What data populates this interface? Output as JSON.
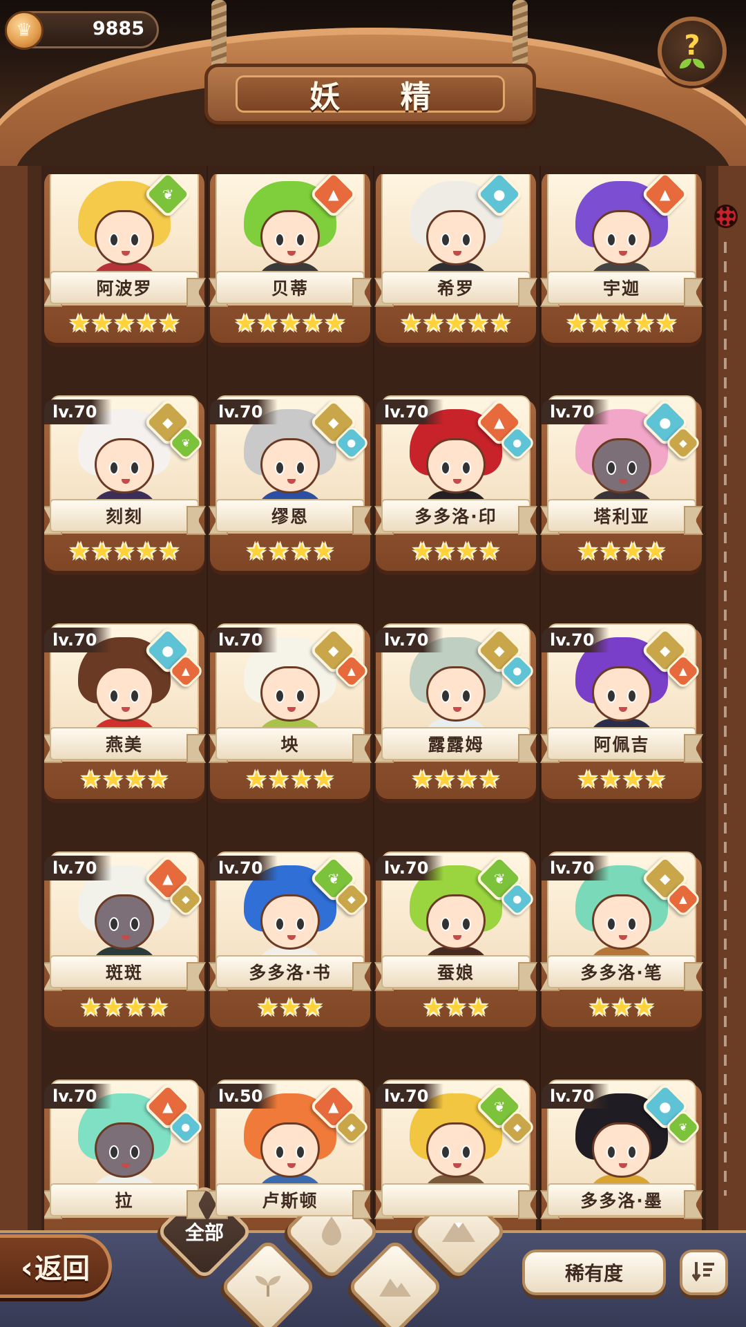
{
  "header": {
    "title": "妖 精",
    "coins": "9885",
    "coin_icon": "crown-coin-icon",
    "help_icon": "question-sprout-icon"
  },
  "colors": {
    "fire": "#e76a3c",
    "leaf": "#7cc23a",
    "water": "#5fc3d6",
    "earth": "#c9a64a",
    "gold_star": "#ffd23c"
  },
  "cards": [
    {
      "name": "阿波罗",
      "level": "",
      "stars": 5,
      "elements": [
        "leaf"
      ],
      "hair": "#f5c94a",
      "outfit": "#b7333a",
      "skin": "light"
    },
    {
      "name": "贝蒂",
      "level": "",
      "stars": 5,
      "elements": [
        "fire"
      ],
      "hair": "#7fcf3c",
      "outfit": "#3a3a3a",
      "skin": "light"
    },
    {
      "name": "希罗",
      "level": "",
      "stars": 5,
      "elements": [
        "water"
      ],
      "hair": "#efece6",
      "outfit": "#2f2f33",
      "skin": "light"
    },
    {
      "name": "宇迦",
      "level": "",
      "stars": 5,
      "elements": [
        "fire"
      ],
      "hair": "#7c4ed1",
      "outfit": "#444",
      "skin": "light"
    },
    {
      "name": "刻刻",
      "level": "lv.70",
      "stars": 5,
      "elements": [
        "earth",
        "leaf"
      ],
      "hair": "#f4f1ee",
      "outfit": "#3b2f5a",
      "skin": "light"
    },
    {
      "name": "缪恩",
      "level": "lv.70",
      "stars": 4,
      "elements": [
        "earth",
        "water"
      ],
      "hair": "#c9c9c9",
      "outfit": "#2d4fa3",
      "skin": "light"
    },
    {
      "name": "多多洛·印",
      "level": "lv.70",
      "stars": 4,
      "elements": [
        "fire",
        "water"
      ],
      "hair": "#c8222a",
      "outfit": "#242024",
      "skin": "light"
    },
    {
      "name": "塔利亚",
      "level": "lv.70",
      "stars": 4,
      "elements": [
        "water",
        "earth"
      ],
      "hair": "#f2a6c8",
      "outfit": "#3a3438",
      "skin": "dark"
    },
    {
      "name": "燕美",
      "level": "lv.70",
      "stars": 4,
      "elements": [
        "water",
        "fire"
      ],
      "hair": "#6a3a24",
      "outfit": "#d0312d",
      "skin": "light"
    },
    {
      "name": "坱",
      "level": "lv.70",
      "stars": 4,
      "elements": [
        "earth",
        "fire"
      ],
      "hair": "#f6f3e9",
      "outfit": "#a8c24a",
      "skin": "light"
    },
    {
      "name": "露露姆",
      "level": "lv.70",
      "stars": 4,
      "elements": [
        "earth",
        "water"
      ],
      "hair": "#bfcfc2",
      "outfit": "#e9eef0",
      "skin": "light"
    },
    {
      "name": "阿佩吉",
      "level": "lv.70",
      "stars": 4,
      "elements": [
        "earth",
        "fire"
      ],
      "hair": "#7a3fc8",
      "outfit": "#2a2e4a",
      "skin": "light"
    },
    {
      "name": "斑斑",
      "level": "lv.70",
      "stars": 4,
      "elements": [
        "fire",
        "earth"
      ],
      "hair": "#f2f2ea",
      "outfit": "#2b3a3a",
      "skin": "dark"
    },
    {
      "name": "多多洛·书",
      "level": "lv.70",
      "stars": 3,
      "elements": [
        "leaf",
        "earth"
      ],
      "hair": "#2f6fd6",
      "outfit": "#f1efe8",
      "skin": "light"
    },
    {
      "name": "蚕娘",
      "level": "lv.70",
      "stars": 3,
      "elements": [
        "leaf",
        "water"
      ],
      "hair": "#9ad43e",
      "outfit": "#4a2b22",
      "skin": "light"
    },
    {
      "name": "多多洛·笔",
      "level": "lv.70",
      "stars": 3,
      "elements": [
        "earth",
        "fire"
      ],
      "hair": "#7ad9b8",
      "outfit": "#b6763a",
      "skin": "light"
    },
    {
      "name": "拉",
      "level": "lv.70",
      "stars": 0,
      "elements": [
        "fire",
        "water"
      ],
      "hair": "#7fe0c4",
      "outfit": "#f0f0ea",
      "skin": "dark"
    },
    {
      "name": "卢斯顿",
      "level": "lv.50",
      "stars": 0,
      "elements": [
        "fire",
        "earth"
      ],
      "hair": "#f07a3a",
      "outfit": "#3a6ab0",
      "skin": "light"
    },
    {
      "name": "",
      "level": "lv.70",
      "stars": 0,
      "elements": [
        "leaf",
        "earth"
      ],
      "hair": "#f2c640",
      "outfit": "#7a5a3a",
      "skin": "light"
    },
    {
      "name": "多多洛·墨",
      "level": "lv.70",
      "stars": 0,
      "elements": [
        "water",
        "leaf"
      ],
      "hair": "#1f1c24",
      "outfit": "#d9a530",
      "skin": "light"
    }
  ],
  "bottom": {
    "back_label": "返回",
    "tabs": [
      {
        "label": "全部",
        "icon": "",
        "active": true
      },
      {
        "label": "",
        "icon": "sprout-icon",
        "active": false
      },
      {
        "label": "",
        "icon": "water-drop-icon",
        "active": false
      },
      {
        "label": "",
        "icon": "mountain-icon",
        "active": false
      },
      {
        "label": "",
        "icon": "volcano-icon",
        "active": false
      }
    ],
    "sort_label": "稀有度",
    "order_icon": "sort-order-icon"
  }
}
